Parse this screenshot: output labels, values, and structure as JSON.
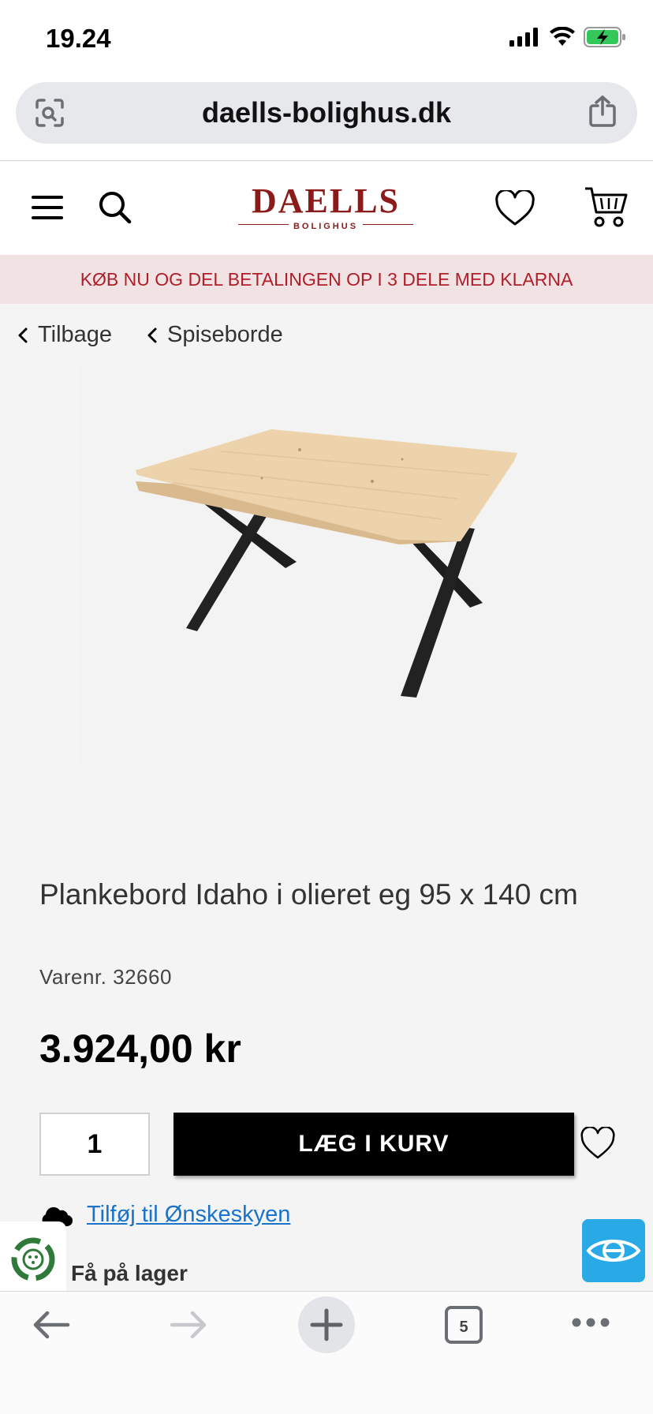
{
  "status_bar": {
    "time": "19.24"
  },
  "browser": {
    "url": "daells-bolighus.dk",
    "tab_count": "5"
  },
  "site": {
    "logo_main": "DAELLS",
    "logo_sub": "BOLIGHUS",
    "promo": "KØB NU OG DEL BETALINGEN OP I 3 DELE MED KLARNA",
    "brand_color": "#8b1a1a",
    "promo_color": "#b01e2a"
  },
  "breadcrumbs": {
    "back": "Tilbage",
    "category": "Spiseborde"
  },
  "product": {
    "title": "Plankebord Idaho i olieret eg 95 x 140 cm",
    "sku": "Varenr. 32660",
    "price": "3.924,00 kr",
    "quantity": "1",
    "add_to_cart_label": "LÆG I KURV",
    "wishcloud_link": "Tilføj til Ønskeskyen",
    "stock": "Få på lager"
  },
  "icons": {
    "menu": "menu-icon",
    "search": "search-icon",
    "favorites": "heart-icon",
    "cart": "cart-icon",
    "back": "back-arrow-icon",
    "forward": "forward-arrow-icon",
    "new_tab": "plus-icon",
    "more": "more-icon"
  }
}
